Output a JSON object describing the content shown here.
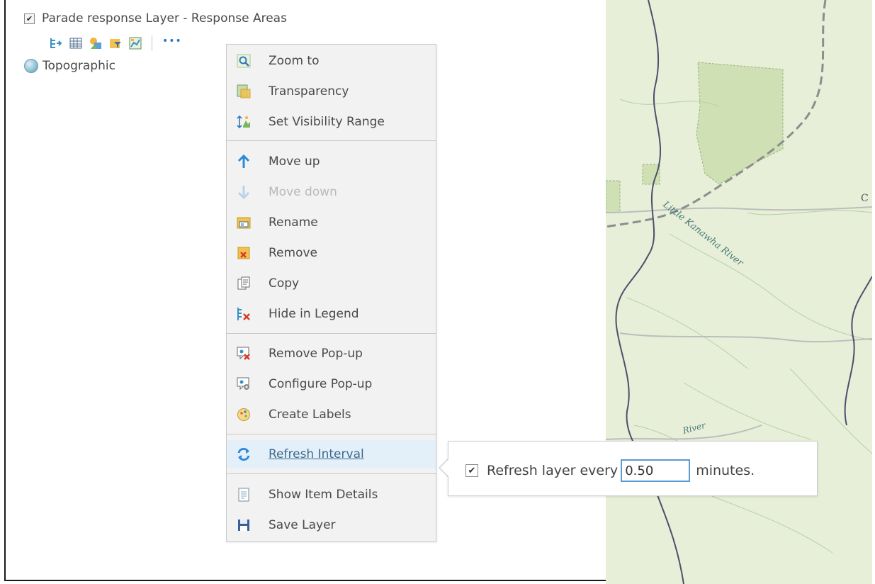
{
  "layer": {
    "name": "Parade response Layer - Response Areas",
    "checked": true,
    "toolbar_icons": [
      "legend-icon",
      "table-icon",
      "change-style-icon",
      "filter-icon",
      "analysis-icon"
    ],
    "more_label": "•••"
  },
  "basemap": {
    "name": "Topographic"
  },
  "map": {
    "river_label_1": "Little Kanawha River",
    "river_label_2": "River",
    "edge_label": "C"
  },
  "menu": {
    "items": [
      {
        "label": "Zoom to",
        "icon": "zoom-to-icon",
        "enabled": true
      },
      {
        "label": "Transparency",
        "icon": "transparency-icon",
        "enabled": true
      },
      {
        "label": "Set Visibility Range",
        "icon": "visibility-range-icon",
        "enabled": true
      },
      {
        "label": "Move up",
        "icon": "arrow-up-icon",
        "enabled": true
      },
      {
        "label": "Move down",
        "icon": "arrow-down-icon",
        "enabled": false
      },
      {
        "label": "Rename",
        "icon": "rename-icon",
        "enabled": true
      },
      {
        "label": "Remove",
        "icon": "remove-icon",
        "enabled": true
      },
      {
        "label": "Copy",
        "icon": "copy-icon",
        "enabled": true
      },
      {
        "label": "Hide in Legend",
        "icon": "hide-in-legend-icon",
        "enabled": true
      },
      {
        "label": "Remove Pop-up",
        "icon": "remove-popup-icon",
        "enabled": true
      },
      {
        "label": "Configure Pop-up",
        "icon": "configure-popup-icon",
        "enabled": true
      },
      {
        "label": "Create Labels",
        "icon": "create-labels-icon",
        "enabled": true
      },
      {
        "label": "Refresh Interval",
        "icon": "refresh-icon",
        "enabled": true,
        "active": true
      },
      {
        "label": "Show Item Details",
        "icon": "item-details-icon",
        "enabled": true
      },
      {
        "label": "Save Layer",
        "icon": "save-icon",
        "enabled": true
      }
    ]
  },
  "refresh_popup": {
    "checked": true,
    "label_before": "Refresh layer every",
    "value": "0.50",
    "label_after": "minutes."
  },
  "colors": {
    "menu_bg": "#f2f2f2",
    "active_bg": "#e4f0f9",
    "input_border": "#5a9bd4",
    "map_bg": "#e7efd9"
  }
}
